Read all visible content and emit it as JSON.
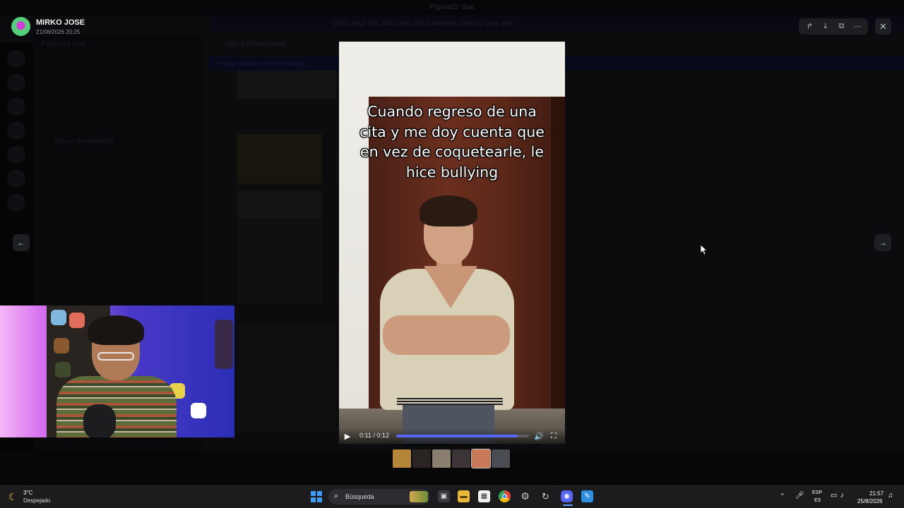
{
  "background_app": {
    "window_title": "Pignox22 chat",
    "server_name": "Pignox22 chat",
    "channel_name": "clips-y-desarmados",
    "banner_text": "Claim your free Nitro trial and customize Discord your way",
    "notice_text": "You're viewing older messages"
  },
  "viewer": {
    "uploader_name": "MIRKO JOSE",
    "upload_date": "21/08/2026 20:25",
    "toolbar": {
      "forward_icon": "forward-icon",
      "download_icon": "download-icon",
      "open_external_icon": "open-external-icon",
      "more_icon": "more-icon"
    },
    "close_icon": "close-icon",
    "prev_icon": "arrow-left-icon",
    "next_icon": "arrow-right-icon",
    "video": {
      "caption": "Cuando regreso de una\ncita y me doy cuenta que\nen vez de coquetearle, le\nhice bullying",
      "time_display": "0:11 / 0:12",
      "progress": 0.917
    },
    "thumbnails": [
      {
        "color": "#b5863a"
      },
      {
        "color": "#2a2422"
      },
      {
        "color": "#8a7e6e"
      },
      {
        "color": "#3c3436"
      },
      {
        "color": "#c87a58"
      },
      {
        "color": "#4a4e52"
      }
    ]
  },
  "taskbar": {
    "weather_temp": "3°C",
    "weather_desc": "Despejado",
    "search_label": "Búsqueda",
    "lang_line1": "ESP",
    "lang_line2": "ES",
    "time": "21:57",
    "date": "25/8/2026",
    "colors": {
      "accent": "#3a9cf4",
      "progress": "#5865f2"
    }
  }
}
